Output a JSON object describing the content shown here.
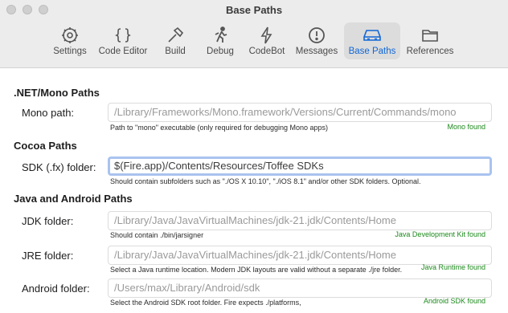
{
  "window": {
    "title": "Base Paths"
  },
  "toolbar": {
    "tabs": [
      {
        "label": "Settings",
        "icon": "gear-icon"
      },
      {
        "label": "Code Editor",
        "icon": "braces-icon"
      },
      {
        "label": "Build",
        "icon": "hammer-icon"
      },
      {
        "label": "Debug",
        "icon": "running-figure-icon"
      },
      {
        "label": "CodeBot",
        "icon": "lightning-bolt-icon"
      },
      {
        "label": "Messages",
        "icon": "exclamation-circle-icon"
      },
      {
        "label": "Base Paths",
        "icon": "hard-drive-icon",
        "selected": true
      },
      {
        "label": "References",
        "icon": "folder-icon"
      }
    ]
  },
  "sections": {
    "mono": {
      "title": ".NET/Mono Paths",
      "mono_path": {
        "label": "Mono path:",
        "placeholder": "/Library/Frameworks/Mono.framework/Versions/Current/Commands/mono",
        "hint": "Path to \"mono\" executable (only required for debugging Mono apps)",
        "status": "Mono found"
      }
    },
    "cocoa": {
      "title": "Cocoa Paths",
      "sdk_folder": {
        "label": "SDK (.fx) folder:",
        "value": "$(Fire.app)/Contents/Resources/Toffee SDKs",
        "hint": "Should contain subfolders such as \"./OS X 10.10\", \"./iOS 8.1\" and/or other SDK folders. Optional."
      }
    },
    "java": {
      "title": "Java and Android Paths",
      "jdk_folder": {
        "label": "JDK folder:",
        "placeholder": "/Library/Java/JavaVirtualMachines/jdk-21.jdk/Contents/Home",
        "hint": "Should contain ./bin/jarsigner",
        "status": "Java Development Kit found"
      },
      "jre_folder": {
        "label": "JRE folder:",
        "placeholder": "/Library/Java/JavaVirtualMachines/jdk-21.jdk/Contents/Home",
        "hint": "Select a Java runtime location. Modern JDK layouts are valid without a separate ./jre folder.",
        "status": "Java Runtime found"
      },
      "android_folder": {
        "label": "Android folder:",
        "placeholder": "/Users/max/Library/Android/sdk",
        "hint": "Select the Android SDK root folder. Fire expects ./platforms,",
        "status": "Android SDK found"
      }
    }
  },
  "colors": {
    "accent": "#1266d6",
    "status_ok": "#1c8a1c",
    "focus_ring": "#a9c3ef"
  }
}
